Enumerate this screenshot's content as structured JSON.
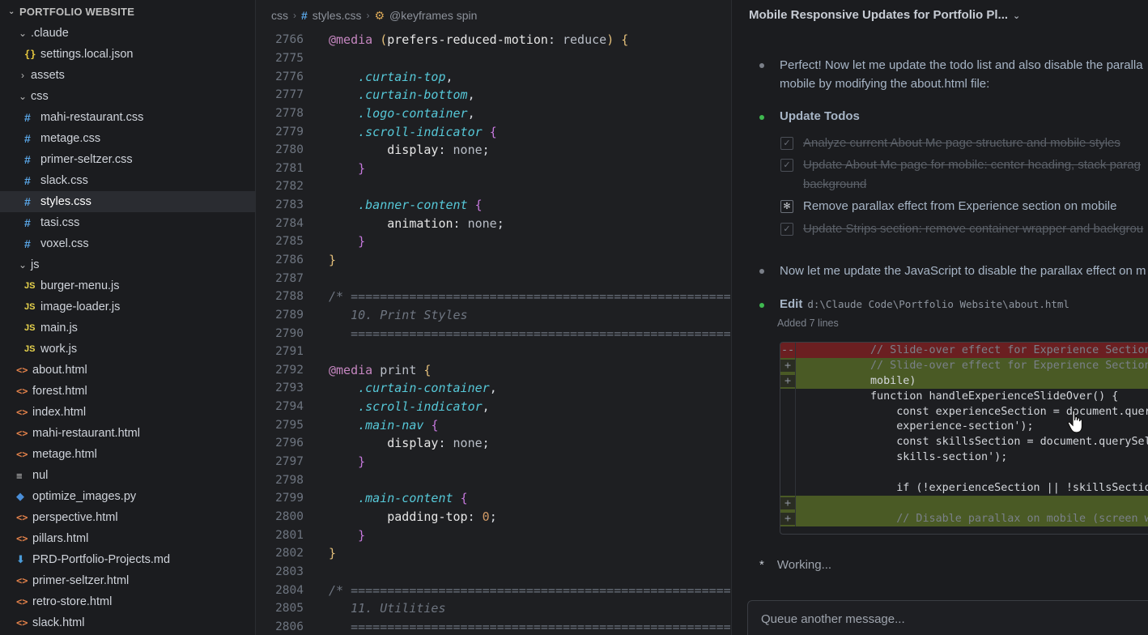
{
  "explorer": {
    "title": "PORTFOLIO WEBSITE",
    "items": [
      {
        "label": ".claude",
        "type": "folder-open",
        "indent": 1
      },
      {
        "label": "settings.local.json",
        "type": "json",
        "indent": 2
      },
      {
        "label": "assets",
        "type": "folder-closed",
        "indent": 1
      },
      {
        "label": "css",
        "type": "folder-open",
        "indent": 1
      },
      {
        "label": "mahi-restaurant.css",
        "type": "css",
        "indent": 2
      },
      {
        "label": "metage.css",
        "type": "css",
        "indent": 2
      },
      {
        "label": "primer-seltzer.css",
        "type": "css",
        "indent": 2
      },
      {
        "label": "slack.css",
        "type": "css",
        "indent": 2
      },
      {
        "label": "styles.css",
        "type": "css",
        "indent": 2,
        "selected": true
      },
      {
        "label": "tasi.css",
        "type": "css",
        "indent": 2
      },
      {
        "label": "voxel.css",
        "type": "css",
        "indent": 2
      },
      {
        "label": "js",
        "type": "folder-open",
        "indent": 1
      },
      {
        "label": "burger-menu.js",
        "type": "js",
        "indent": 2
      },
      {
        "label": "image-loader.js",
        "type": "js",
        "indent": 2
      },
      {
        "label": "main.js",
        "type": "js",
        "indent": 2
      },
      {
        "label": "work.js",
        "type": "js",
        "indent": 2
      },
      {
        "label": "about.html",
        "type": "html",
        "indent": 1
      },
      {
        "label": "forest.html",
        "type": "html",
        "indent": 1
      },
      {
        "label": "index.html",
        "type": "html",
        "indent": 1
      },
      {
        "label": "mahi-restaurant.html",
        "type": "html",
        "indent": 1
      },
      {
        "label": "metage.html",
        "type": "html",
        "indent": 1
      },
      {
        "label": "nul",
        "type": "txt",
        "indent": 1
      },
      {
        "label": "optimize_images.py",
        "type": "py",
        "indent": 1
      },
      {
        "label": "perspective.html",
        "type": "html",
        "indent": 1
      },
      {
        "label": "pillars.html",
        "type": "html",
        "indent": 1
      },
      {
        "label": "PRD-Portfolio-Projects.md",
        "type": "md",
        "indent": 1
      },
      {
        "label": "primer-seltzer.html",
        "type": "html",
        "indent": 1
      },
      {
        "label": "retro-store.html",
        "type": "html",
        "indent": 1
      },
      {
        "label": "slack.html",
        "type": "html",
        "indent": 1
      }
    ]
  },
  "breadcrumb": {
    "folder": "css",
    "file": "styles.css",
    "symbol": "@keyframes spin"
  },
  "code_lines": [
    {
      "n": "2766",
      "html": "<span class=\"k-at\">@media</span> <span class=\"k-paren\">(</span><span class=\"k-prop\">prefers-reduced-motion</span>: <span class=\"k-val\">reduce</span><span class=\"k-paren\">)</span> <span class=\"k-brace-y\">{</span>"
    },
    {
      "n": "2775",
      "html": ""
    },
    {
      "n": "2776",
      "html": "    <span class=\"k-sel\">.curtain-top</span>,"
    },
    {
      "n": "2777",
      "html": "    <span class=\"k-sel\">.curtain-bottom</span>,"
    },
    {
      "n": "2778",
      "html": "    <span class=\"k-sel\">.logo-container</span>,"
    },
    {
      "n": "2779",
      "html": "    <span class=\"k-sel\">.scroll-indicator</span> <span class=\"k-brace-p\">{</span>"
    },
    {
      "n": "2780",
      "html": "        <span class=\"k-prop\">display</span>: <span class=\"k-val\">none</span>;"
    },
    {
      "n": "2781",
      "html": "    <span class=\"k-brace-p\">}</span>"
    },
    {
      "n": "2782",
      "html": ""
    },
    {
      "n": "2783",
      "html": "    <span class=\"k-sel\">.banner-content</span> <span class=\"k-brace-p\">{</span>"
    },
    {
      "n": "2784",
      "html": "        <span class=\"k-prop\">animation</span>: <span class=\"k-val\">none</span>;"
    },
    {
      "n": "2785",
      "html": "    <span class=\"k-brace-p\">}</span>"
    },
    {
      "n": "2786",
      "html": "<span class=\"k-brace-y\">}</span>"
    },
    {
      "n": "2787",
      "html": ""
    },
    {
      "n": "2788",
      "html": "<span class=\"k-cmt\">/* ==========================================================</span>"
    },
    {
      "n": "2789",
      "html": "<span class=\"k-cmt\">   10. Print Styles</span>"
    },
    {
      "n": "2790",
      "html": "<span class=\"k-cmt\">   ==========================================================</span>"
    },
    {
      "n": "2791",
      "html": ""
    },
    {
      "n": "2792",
      "html": "<span class=\"k-at\">@media</span> <span class=\"k-val\">print</span> <span class=\"k-brace-y\">{</span>"
    },
    {
      "n": "2793",
      "html": "    <span class=\"k-sel\">.curtain-container</span>,"
    },
    {
      "n": "2794",
      "html": "    <span class=\"k-sel\">.scroll-indicator</span>,"
    },
    {
      "n": "2795",
      "html": "    <span class=\"k-sel\">.main-nav</span> <span class=\"k-brace-p\">{</span>"
    },
    {
      "n": "2796",
      "html": "        <span class=\"k-prop\">display</span>: <span class=\"k-val\">none</span>;"
    },
    {
      "n": "2797",
      "html": "    <span class=\"k-brace-p\">}</span>"
    },
    {
      "n": "2798",
      "html": ""
    },
    {
      "n": "2799",
      "html": "    <span class=\"k-sel\">.main-content</span> <span class=\"k-brace-p\">{</span>"
    },
    {
      "n": "2800",
      "html": "        <span class=\"k-prop\">padding-top</span>: <span class=\"k-num\">0</span>;"
    },
    {
      "n": "2801",
      "html": "    <span class=\"k-brace-p\">}</span>"
    },
    {
      "n": "2802",
      "html": "<span class=\"k-brace-y\">}</span>"
    },
    {
      "n": "2803",
      "html": ""
    },
    {
      "n": "2804",
      "html": "<span class=\"k-cmt\">/* ==========================================================</span>"
    },
    {
      "n": "2805",
      "html": "<span class=\"k-cmt\">   11. Utilities</span>"
    },
    {
      "n": "2806",
      "html": "<span class=\"k-cmt\">   ==========================================================</span>"
    }
  ],
  "chat": {
    "title": "Mobile Responsive Updates for Portfolio Pl...",
    "msg1_line1": "Perfect! Now let me update the todo list and also disable the paralla",
    "msg1_line2": "mobile by modifying the about.html file:",
    "todo_title": "Update Todos",
    "todos": [
      {
        "text": "Analyze current About Me page structure and mobile styles",
        "state": "done"
      },
      {
        "text": "Update About Me page for mobile: center heading, stack parag",
        "text2": "background",
        "state": "done"
      },
      {
        "text": "Remove parallax effect from Experience section on mobile",
        "state": "active"
      },
      {
        "text": "Update Strips section: remove container wrapper and backgrou",
        "state": "done"
      }
    ],
    "msg2": "Now let me update the JavaScript to disable the parallax effect on m",
    "edit_label": "Edit",
    "edit_path": "d:\\Claude Code\\Portfolio Website\\about.html",
    "added": "Added 7 lines",
    "diff": [
      {
        "mark": "--",
        "kind": "del",
        "text": "// Slide-over effect for Experience Section",
        "cls": "dc"
      },
      {
        "mark": "+",
        "kind": "add",
        "text": "// Slide-over effect for Experience Section",
        "cls": "dc"
      },
      {
        "mark": "+",
        "kind": "add",
        "text": "mobile)",
        "cls": ""
      },
      {
        "mark": "",
        "kind": "",
        "text": "function handleExperienceSlideOver() {",
        "cls": ""
      },
      {
        "mark": "",
        "kind": "",
        "text": "    const experienceSection = document.queryS",
        "cls": ""
      },
      {
        "mark": "",
        "kind": "",
        "text": "    experience-section');",
        "cls": ""
      },
      {
        "mark": "",
        "kind": "",
        "text": "    const skillsSection = document.querySele",
        "cls": ""
      },
      {
        "mark": "",
        "kind": "",
        "text": "    skills-section');",
        "cls": ""
      },
      {
        "mark": "",
        "kind": "",
        "text": "",
        "cls": ""
      },
      {
        "mark": "",
        "kind": "",
        "text": "    if (!experienceSection || !skillsSection",
        "cls": ""
      },
      {
        "mark": "+",
        "kind": "add",
        "text": "",
        "cls": ""
      },
      {
        "mark": "+",
        "kind": "add",
        "text": "    // Disable parallax on mobile (screen wid",
        "cls": "dc"
      }
    ],
    "working": "Working...",
    "input_placeholder": "Queue another message..."
  }
}
